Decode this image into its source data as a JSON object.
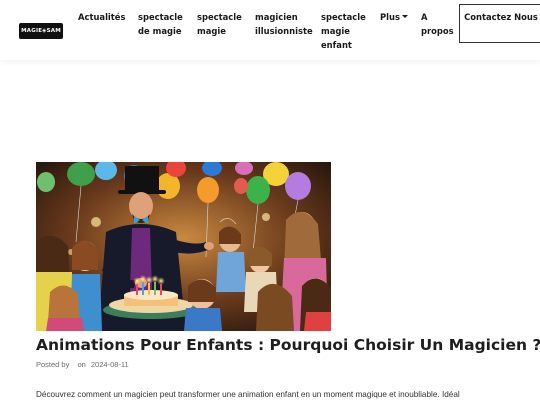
{
  "header": {
    "logo_text": "MAGIE◈SAM",
    "nav": [
      {
        "label": "Actualités"
      },
      {
        "label": "spectacle de magie"
      },
      {
        "label": "spectacle magie"
      },
      {
        "label": "magicien illusionniste"
      },
      {
        "label": "spectacle magie enfant"
      },
      {
        "label": "Plus"
      },
      {
        "label": "A propos"
      }
    ],
    "contact_label": "Contactez Nous"
  },
  "post": {
    "image_alt": "Magicien avec chapeau haut-de-forme et enfants autour d'un gâteau d'anniversaire avec ballons",
    "title": "Animations Pour Enfants : Pourquoi Choisir Un Magicien ?",
    "meta_prefix": "Posted by",
    "meta_author": "",
    "meta_on": "on",
    "meta_date": "2024-08-11",
    "excerpt": "Découvrez comment un magicien peut transformer une animation enfant en un moment magique et inoubliable. Idéal"
  },
  "colors": {
    "nav_text": "#1a1a1a",
    "title_text": "#1e1e1e",
    "meta_text": "#6b6b6b"
  }
}
